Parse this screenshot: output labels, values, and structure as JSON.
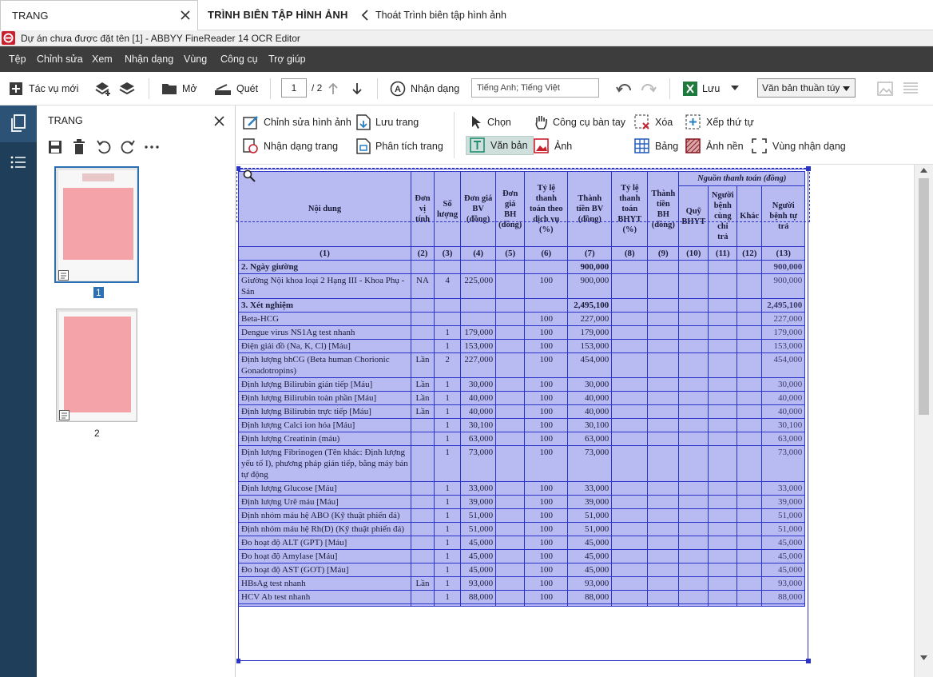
{
  "tabs": {
    "active_tab": "TRANG",
    "editor_title": "TRÌNH BIÊN TẬP HÌNH ẢNH",
    "exit_label": "Thoát Trình biên tập hình ảnh"
  },
  "window": {
    "title": "Dự án chưa được đặt tên [1] - ABBYY FineReader 14 OCR Editor"
  },
  "menu": [
    "Tệp",
    "Chỉnh sửa",
    "Xem",
    "Nhận dạng",
    "Vùng",
    "Công cụ",
    "Trợ giúp"
  ],
  "toolbar": {
    "new_task": "Tác vụ mới",
    "open": "Mở",
    "scan": "Quét",
    "page_current": "1",
    "page_total": "/ 2",
    "recognize": "Nhận dạng",
    "language": "Tiếng Anh; Tiếng Việt",
    "save": "Lưu",
    "format": "Văn bản thuần túy"
  },
  "pages_panel": {
    "title": "TRANG",
    "thumbnails": [
      {
        "label": "1"
      },
      {
        "label": "2"
      }
    ]
  },
  "edit_tools": {
    "edit_image": "Chỉnh sửa hình ảnh",
    "save_page": "Lưu trang",
    "select": "Chọn",
    "hand": "Công cụ bàn tay",
    "delete": "Xóa",
    "reorder": "Xếp thứ tự",
    "recognize_page": "Nhận dạng trang",
    "analyze_page": "Phân tích trang",
    "text": "Văn bản",
    "image": "Ảnh",
    "table": "Bảng",
    "background": "Ảnh nền",
    "recog_area": "Vùng nhận dạng"
  },
  "table": {
    "headers": {
      "content": "Nội dung",
      "unit": "Đơn vị tính",
      "qty": "Số lượng",
      "price_bv": "Đơn giá BV (đồng)",
      "price_bh": "Đơn giá BH (đồng)",
      "rate": "Tỷ lệ thanh toán theo dịch vụ (%)",
      "amount_bv": "Thành tiền BV (đồng)",
      "rate_bhyt": "Tỷ lệ thanh toán BHYT (%)",
      "amount_bh": "Thành tiền BH (đồng)",
      "source_group": "Nguồn thanh toán (đồng)",
      "bhyt_fund": "Quỹ BHYT",
      "copay": "Người bệnh cùng chi trả",
      "other": "Khác",
      "patient_pays": "Người bệnh tự trả"
    },
    "col_index": [
      "(1)",
      "(2)",
      "(3)",
      "(4)",
      "(5)",
      "(6)",
      "(7)",
      "(8)",
      "(9)",
      "(10)",
      "(11)",
      "(12)",
      "(13)"
    ],
    "rows": [
      {
        "section": true,
        "content": "2. Ngày giường",
        "unit": "",
        "qty": "",
        "price": "",
        "rate": "",
        "amount": "900,000",
        "self": "900,000"
      },
      {
        "content": "Giường Nội khoa loại 2 Hạng III - Khoa Phụ - Sản",
        "unit": "NA",
        "qty": "4",
        "price": "225,000",
        "rate": "100",
        "amount": "900,000",
        "self": "900,000"
      },
      {
        "section": true,
        "content": "3. Xét nghiệm",
        "unit": "",
        "qty": "",
        "price": "",
        "rate": "",
        "amount": "2,495,100",
        "self": "2,495,100"
      },
      {
        "content": "Beta-HCG",
        "unit": "",
        "qty": "",
        "price": "",
        "rate": "100",
        "amount": "227,000",
        "self": "227,000"
      },
      {
        "content": "Dengue virus NS1Ag test nhanh",
        "unit": "",
        "qty": "1",
        "price": "179,000",
        "rate": "100",
        "amount": "179,000",
        "self": "179,000"
      },
      {
        "content": "Điện giải đồ (Na, K, Cl) [Máu]",
        "unit": "",
        "qty": "1",
        "price": "153,000",
        "rate": "100",
        "amount": "153,000",
        "self": "153,000"
      },
      {
        "content": "Định lượng bhCG (Beta human Chorionic Gonadotropins)",
        "unit": "Lần",
        "qty": "2",
        "price": "227,000",
        "rate": "100",
        "amount": "454,000",
        "self": "454,000"
      },
      {
        "content": "Định lượng Bilirubin gián tiếp [Máu]",
        "unit": "Lần",
        "qty": "1",
        "price": "30,000",
        "rate": "100",
        "amount": "30,000",
        "self": "30,000"
      },
      {
        "content": "Định lượng Bilirubin toàn phần [Máu]",
        "unit": "Lần",
        "qty": "1",
        "price": "40,000",
        "rate": "100",
        "amount": "40,000",
        "self": "40,000"
      },
      {
        "content": "Định lượng Bilirubin trực tiếp [Máu]",
        "unit": "Lần",
        "qty": "1",
        "price": "40,000",
        "rate": "100",
        "amount": "40,000",
        "self": "40,000"
      },
      {
        "content": "Định lượng Calci ion hóa [Máu]",
        "unit": "",
        "qty": "1",
        "price": "30,100",
        "rate": "100",
        "amount": "30,100",
        "self": "30,100"
      },
      {
        "content": "Định lượng Creatinin (máu)",
        "unit": "",
        "qty": "1",
        "price": "63,000",
        "rate": "100",
        "amount": "63,000",
        "self": "63,000"
      },
      {
        "content": "Định lượng Fibrinogen (Tên khác: Định lượng yếu tố I), phương pháp gián tiếp, bằng máy bán tự động",
        "unit": "",
        "qty": "1",
        "price": "73,000",
        "rate": "100",
        "amount": "73,000",
        "self": "73,000"
      },
      {
        "content": "Định lượng Glucose [Máu]",
        "unit": "",
        "qty": "1",
        "price": "33,000",
        "rate": "100",
        "amount": "33,000",
        "self": "33,000"
      },
      {
        "content": "Định lượng Urê máu [Máu]",
        "unit": "",
        "qty": "1",
        "price": "39,000",
        "rate": "100",
        "amount": "39,000",
        "self": "39,000"
      },
      {
        "content": "Định nhóm máu hệ ABO (Kỹ thuật phiến đá)",
        "unit": "",
        "qty": "1",
        "price": "51,000",
        "rate": "100",
        "amount": "51,000",
        "self": "51,000"
      },
      {
        "content": "Định nhóm máu hệ Rh(D) (Kỹ thuật phiến đá)",
        "unit": "",
        "qty": "1",
        "price": "51,000",
        "rate": "100",
        "amount": "51,000",
        "self": "51,000"
      },
      {
        "content": "Đo hoạt độ ALT (GPT) [Máu]",
        "unit": "",
        "qty": "1",
        "price": "45,000",
        "rate": "100",
        "amount": "45,000",
        "self": "45,000"
      },
      {
        "content": "Đo hoạt độ Amylase [Máu]",
        "unit": "",
        "qty": "1",
        "price": "45,000",
        "rate": "100",
        "amount": "45,000",
        "self": "45,000"
      },
      {
        "content": "Đo hoạt độ AST (GOT) [Máu]",
        "unit": "",
        "qty": "1",
        "price": "45,000",
        "rate": "100",
        "amount": "45,000",
        "self": "45,000"
      },
      {
        "content": "HBsAg test nhanh",
        "unit": "Lần",
        "qty": "1",
        "price": "93,000",
        "rate": "100",
        "amount": "93,000",
        "self": "93,000"
      },
      {
        "content": "HCV Ab test nhanh",
        "unit": "",
        "qty": "1",
        "price": "88,000",
        "rate": "100",
        "amount": "88,000",
        "self": "88,000"
      },
      {
        "content": "",
        "unit": "",
        "qty": "",
        "price": "",
        "rate": "",
        "amount": "",
        "self": ""
      }
    ]
  },
  "colors": {
    "menubar": "#3d3d3d",
    "navrail": "#1e3e5a",
    "table_fill": "#b8bbf2",
    "table_border": "#2b33c8",
    "annotation": "#e0102a"
  }
}
